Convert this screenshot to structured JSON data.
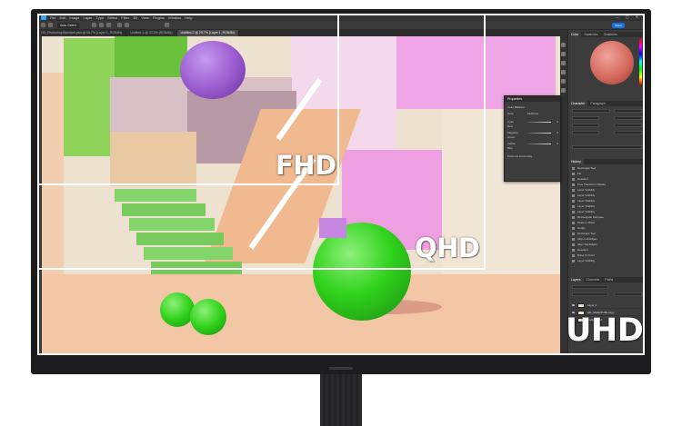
{
  "app": {
    "title_bar_menus": [
      "File",
      "Edit",
      "Image",
      "Layer",
      "Type",
      "Select",
      "Filter",
      "3D",
      "View",
      "Plugins",
      "Window",
      "Help"
    ],
    "share_label": "Share",
    "preset_label": "Auto-Select",
    "document_tabs": [
      {
        "label": "HD_PhotoshopStandard.psb @ 66.7% (Layer 1, RGB/8#)",
        "active": false
      },
      {
        "label": "Untitled-1 @ 33.3% (RGB/8#)",
        "active": false
      },
      {
        "label": "Untitled-2 @ 25.7% (Layer 1, RGB/8#)",
        "active": true
      }
    ]
  },
  "right_panels": {
    "color_tabs": [
      "Color",
      "Swatches",
      "Gradients"
    ],
    "character_tabs": [
      "Character",
      "Paragraph"
    ],
    "character_font": "Samsung Sharp",
    "character_style": "Medium",
    "history_tab": "History",
    "history_items": [
      "Rectangle Tool",
      "Fill",
      "Deselect",
      "Free Transform (Stack)",
      "Layer Visibility",
      "Layer Visibility",
      "Layer Visibility",
      "Layer Visibility",
      "Layer Visibility",
      "Rectangular Marquee",
      "Paste in Place",
      "Nudge",
      "Rectangle Tool",
      "Align Left Edges",
      "Align Top Edges",
      "Deselect",
      "Bring To Front",
      "Layer Visibility"
    ],
    "layers_tabs": [
      "Layers",
      "Channels",
      "Paths"
    ],
    "layers": [
      "Layer 1",
      "HD_SMARTOBJ copy",
      "Background"
    ]
  },
  "properties_panel": {
    "title": "Properties",
    "sub": "Color Balance",
    "tone_label": "Tone",
    "tone_value": "Midtones",
    "sliders": [
      {
        "label": "Cyan",
        "end_label": "Red",
        "value": "0"
      },
      {
        "label": "Magenta",
        "end_label": "Green",
        "value": "0"
      },
      {
        "label": "Yellow",
        "end_label": "Blue",
        "value": "0"
      }
    ],
    "preserve_label": "Preserve Luminosity"
  },
  "overlays": {
    "fhd": "FHD",
    "qhd": "QHD",
    "uhd": "UHD"
  },
  "colors": {
    "accent": "#31a8ff",
    "share_button": "#1473e6",
    "ball_green": "#31d31c",
    "purple_ball": "#9d5fd1",
    "pink_wall": "#f0a6e6",
    "lime_wall": "#8fd35a",
    "floor": "#f3c7a6"
  }
}
